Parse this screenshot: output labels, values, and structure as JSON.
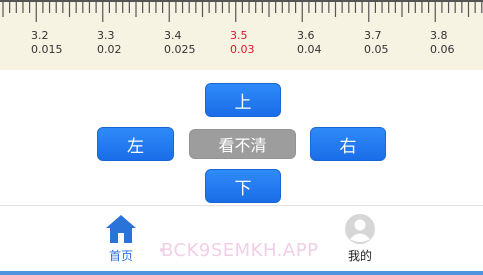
{
  "ruler": {
    "scale": [
      {
        "line": "3.2",
        "acuity": "0.015",
        "active": false
      },
      {
        "line": "3.3",
        "acuity": "0.02",
        "active": false
      },
      {
        "line": "3.4",
        "acuity": "0.025",
        "active": false
      },
      {
        "line": "3.5",
        "acuity": "0.03",
        "active": true
      },
      {
        "line": "3.6",
        "acuity": "0.04",
        "active": false
      },
      {
        "line": "3.7",
        "acuity": "0.05",
        "active": false
      },
      {
        "line": "3.8",
        "acuity": "0.06",
        "active": false
      }
    ],
    "active_color": "#e0142d"
  },
  "pad": {
    "up": "上",
    "left": "左",
    "unclear": "看不清",
    "right": "右",
    "down": "下"
  },
  "tabbar": {
    "home": {
      "label": "首页",
      "icon": "home-icon"
    },
    "mine": {
      "label": "我的",
      "icon": "avatar-icon"
    },
    "watermark": "BCK9SEMKH.APP"
  },
  "colors": {
    "button_blue": "#1f77f0",
    "button_grey": "#9d9d9d",
    "tab_active": "#2a73d9",
    "ruler_bg": "#f7f3e3"
  }
}
